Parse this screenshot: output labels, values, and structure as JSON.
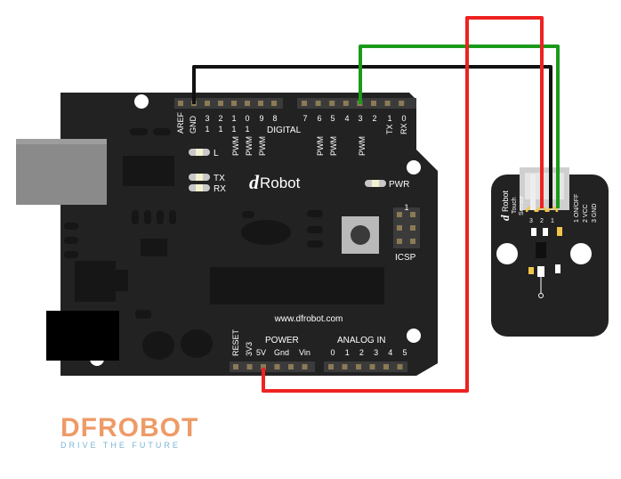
{
  "board": {
    "brand": "Robot",
    "brand_letter": "d",
    "url": "www.dfrobot.com",
    "top_pins": [
      "AREF",
      "GND",
      "3\n1",
      "2\n1",
      "1\n1",
      "0\n1",
      "9",
      "8",
      "7",
      "6",
      "5",
      "4",
      "3",
      "2",
      "1\nTX",
      "0\nRX"
    ],
    "top_pin_labels": [
      "AREF",
      "GND",
      "13",
      "12",
      "11",
      "10",
      "9",
      "8",
      "7",
      "6",
      "5",
      "4",
      "3",
      "2",
      "1",
      "0"
    ],
    "digital_label": "DIGITAL",
    "pwm_label": "PWM",
    "tx_label": "TX",
    "rx_label": "RX",
    "l_label": "L",
    "pwr_label": "PWR",
    "icsp_label": "ICSP",
    "icsp_num": "1",
    "power_label": "POWER",
    "analog_label": "ANALOG IN",
    "power_pins": [
      "RESET",
      "3V3",
      "5V",
      "Gnd",
      "Vin"
    ],
    "analog_pins": [
      "0",
      "1",
      "2",
      "3",
      "4",
      "5"
    ]
  },
  "sensor": {
    "brand": "Robot",
    "brand_letter": "d",
    "name": "Touch",
    "type": "Sensor",
    "pin_numbers": [
      "3",
      "2",
      "1"
    ],
    "pin_names": [
      "1 ON/OFF",
      "2 VCC",
      "3 GND"
    ]
  },
  "wires": {
    "gnd_color": "#111111",
    "signal_color": "#1a9a1a",
    "power_color": "#ee2222"
  },
  "logo": {
    "word": "DFROBOT",
    "tagline": "DRIVE THE FUTURE",
    "color": "#ee9b67",
    "tag_color": "#79b5d6"
  }
}
